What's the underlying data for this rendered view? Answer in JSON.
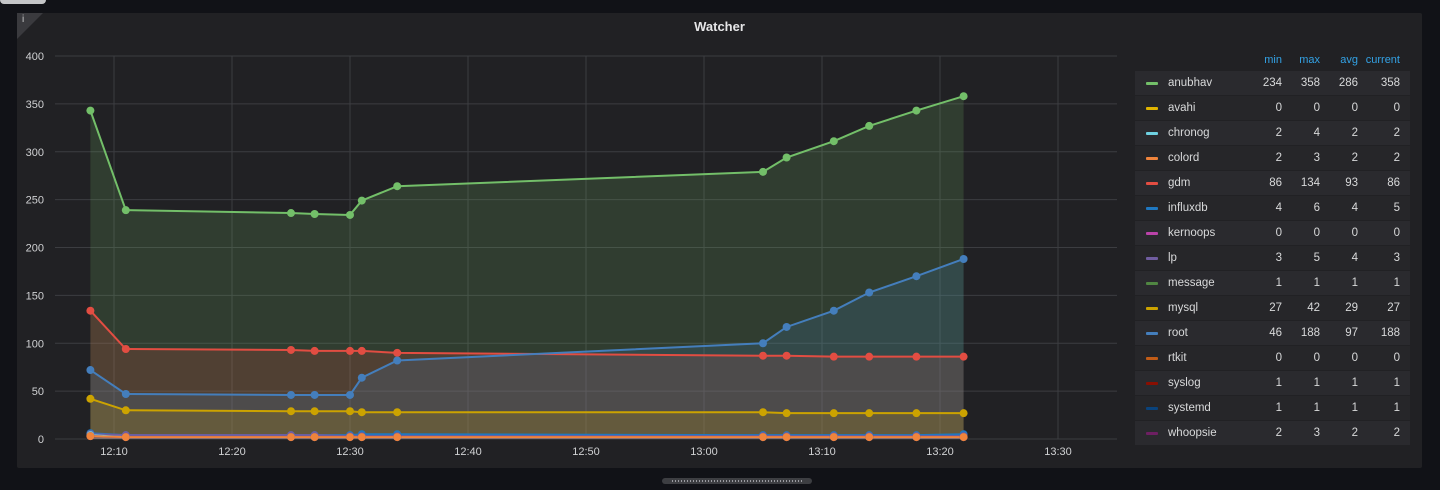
{
  "panel": {
    "title": "Watcher",
    "info_glyph": "i"
  },
  "legend": {
    "headers": {
      "min": "min",
      "max": "max",
      "avg": "avg",
      "current": "current"
    },
    "rows": [
      {
        "name": "anubhav",
        "color": "#73bf69",
        "min": "234",
        "max": "358",
        "avg": "286",
        "current": "358"
      },
      {
        "name": "avahi",
        "color": "#e0b400",
        "min": "0",
        "max": "0",
        "avg": "0",
        "current": "0"
      },
      {
        "name": "chronog",
        "color": "#6ed0e0",
        "min": "2",
        "max": "4",
        "avg": "2",
        "current": "2"
      },
      {
        "name": "colord",
        "color": "#ef843c",
        "min": "2",
        "max": "3",
        "avg": "2",
        "current": "2"
      },
      {
        "name": "gdm",
        "color": "#e24d42",
        "min": "86",
        "max": "134",
        "avg": "93",
        "current": "86"
      },
      {
        "name": "influxdb",
        "color": "#1f78c1",
        "min": "4",
        "max": "6",
        "avg": "4",
        "current": "5"
      },
      {
        "name": "kernoops",
        "color": "#ba43a9",
        "min": "0",
        "max": "0",
        "avg": "0",
        "current": "0"
      },
      {
        "name": "lp",
        "color": "#705da0",
        "min": "3",
        "max": "5",
        "avg": "4",
        "current": "3"
      },
      {
        "name": "message",
        "color": "#508642",
        "min": "1",
        "max": "1",
        "avg": "1",
        "current": "1"
      },
      {
        "name": "mysql",
        "color": "#cca300",
        "min": "27",
        "max": "42",
        "avg": "29",
        "current": "27"
      },
      {
        "name": "root",
        "color": "#447ebc",
        "min": "46",
        "max": "188",
        "avg": "97",
        "current": "188"
      },
      {
        "name": "rtkit",
        "color": "#c15c17",
        "min": "0",
        "max": "0",
        "avg": "0",
        "current": "0"
      },
      {
        "name": "syslog",
        "color": "#890f02",
        "min": "1",
        "max": "1",
        "avg": "1",
        "current": "1"
      },
      {
        "name": "systemd",
        "color": "#0a437c",
        "min": "1",
        "max": "1",
        "avg": "1",
        "current": "1"
      },
      {
        "name": "whoopsie",
        "color": "#6d1f62",
        "min": "2",
        "max": "3",
        "avg": "2",
        "current": "2"
      }
    ]
  },
  "chart_data": {
    "type": "area",
    "title": "Watcher",
    "xlabel": "",
    "ylabel": "",
    "ylim": [
      0,
      400
    ],
    "yticks": [
      0,
      50,
      100,
      150,
      200,
      250,
      300,
      350,
      400
    ],
    "xlim": [
      "12:05",
      "13:35"
    ],
    "xticks": [
      "12:10",
      "12:20",
      "12:30",
      "12:40",
      "12:50",
      "13:00",
      "13:10",
      "13:20",
      "13:30"
    ],
    "grid": true,
    "legend_position": "right",
    "x": [
      "12:08",
      "12:11",
      "12:25",
      "12:27",
      "12:30",
      "12:31",
      "12:34",
      "13:05",
      "13:07",
      "13:11",
      "13:14",
      "13:18",
      "13:22"
    ],
    "series": [
      {
        "name": "anubhav",
        "color": "#73bf69",
        "fill": true,
        "values": [
          343,
          239,
          236,
          235,
          234,
          249,
          264,
          279,
          294,
          311,
          327,
          343,
          358
        ]
      },
      {
        "name": "gdm",
        "color": "#e24d42",
        "fill": true,
        "values": [
          134,
          94,
          93,
          92,
          92,
          92,
          90,
          87,
          87,
          86,
          86,
          86,
          86
        ]
      },
      {
        "name": "root",
        "color": "#447ebc",
        "fill": true,
        "values": [
          72,
          47,
          46,
          46,
          46,
          64,
          82,
          100,
          117,
          134,
          153,
          170,
          188
        ]
      },
      {
        "name": "mysql",
        "color": "#cca300",
        "fill": true,
        "values": [
          42,
          30,
          29,
          29,
          29,
          28,
          28,
          28,
          27,
          27,
          27,
          27,
          27
        ]
      },
      {
        "name": "influxdb",
        "color": "#1f78c1",
        "fill": true,
        "values": [
          6,
          4,
          4,
          4,
          4,
          5,
          5,
          4,
          4,
          4,
          4,
          4,
          5
        ]
      },
      {
        "name": "lp",
        "color": "#705da0",
        "fill": true,
        "values": [
          5,
          4,
          4,
          4,
          3,
          3,
          3,
          3,
          3,
          3,
          3,
          3,
          3
        ]
      },
      {
        "name": "chronog",
        "color": "#6ed0e0",
        "fill": true,
        "values": [
          4,
          2,
          2,
          2,
          2,
          2,
          2,
          2,
          2,
          2,
          2,
          2,
          2
        ]
      },
      {
        "name": "whoopsie",
        "color": "#6d1f62",
        "fill": true,
        "values": [
          3,
          2,
          2,
          2,
          2,
          2,
          2,
          2,
          2,
          2,
          2,
          2,
          2
        ]
      },
      {
        "name": "colord",
        "color": "#ef843c",
        "fill": true,
        "values": [
          3,
          2,
          2,
          2,
          2,
          2,
          2,
          2,
          2,
          2,
          2,
          2,
          2
        ]
      }
    ]
  }
}
